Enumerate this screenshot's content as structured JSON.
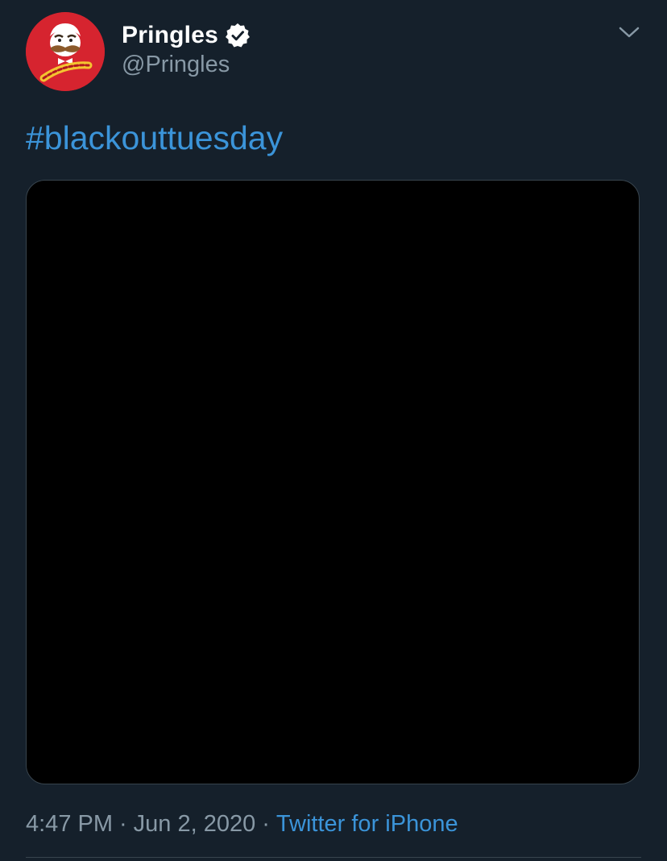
{
  "tweet": {
    "author": {
      "display_name": "Pringles",
      "handle": "@Pringles",
      "verified": true,
      "avatar_logo_text": "Pringles",
      "avatar_icon": "pringles-logo-icon"
    },
    "text": "#blackouttuesday",
    "media": {
      "description_color": "#000000"
    },
    "meta": {
      "time": "4:47 PM",
      "separator": "·",
      "date": "Jun 2, 2020",
      "source": "Twitter for iPhone"
    },
    "menu_icon": "chevron-down-icon"
  },
  "colors": {
    "background": "#15202b",
    "accent": "#3b94d9",
    "secondary_text": "#8899a6",
    "border": "#38444d",
    "avatar_bg": "#d6242f"
  }
}
